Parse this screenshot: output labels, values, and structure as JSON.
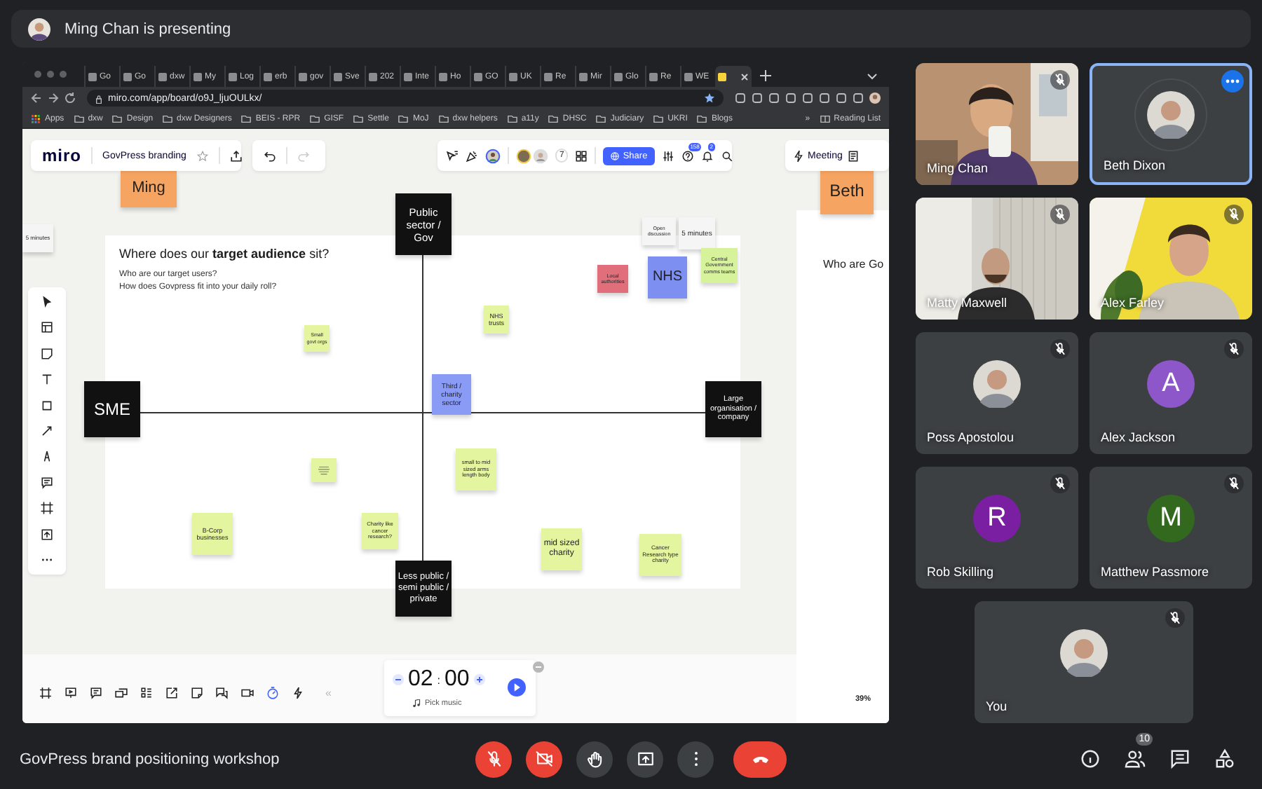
{
  "presenter_banner": {
    "text": "Ming Chan is presenting"
  },
  "browser": {
    "tabs": [
      {
        "label": "Go",
        "selected": false
      },
      {
        "label": "Go",
        "selected": false
      },
      {
        "label": "dxw",
        "selected": false
      },
      {
        "label": "My",
        "selected": false
      },
      {
        "label": "Log",
        "selected": false
      },
      {
        "label": "erb",
        "selected": false
      },
      {
        "label": "gov",
        "selected": false
      },
      {
        "label": "Sve",
        "selected": false
      },
      {
        "label": "202",
        "selected": false
      },
      {
        "label": "Inte",
        "selected": false
      },
      {
        "label": "Ho",
        "selected": false
      },
      {
        "label": "GO",
        "selected": false
      },
      {
        "label": "UK",
        "selected": false
      },
      {
        "label": "Re",
        "selected": false
      },
      {
        "label": "Mir",
        "selected": false
      },
      {
        "label": "Glo",
        "selected": false
      },
      {
        "label": "Re",
        "selected": false
      },
      {
        "label": "WE",
        "selected": false
      },
      {
        "selected": true
      }
    ],
    "address": "miro.com/app/board/o9J_ljuOULkx/",
    "bookmarks": [
      "Apps",
      "dxw",
      "Design",
      "dxw Designers",
      "BEIS - RPR",
      "GISF",
      "Settle",
      "MoJ",
      "dxw helpers",
      "a11y",
      "DHSC",
      "Judiciary",
      "UKRI",
      "Blogs"
    ],
    "bookmarks_more": "»",
    "reading_list": "Reading List"
  },
  "miro": {
    "logo": "miro",
    "board_title": "GovPress branding",
    "collaborator_count": "7",
    "share_label": "Share",
    "help_badge": "158",
    "notifications_badge": "2",
    "meeting_label": "Meeting",
    "frame": {
      "heading": "Where does our **target audience** sit?",
      "lines": [
        "Who are our target users?",
        "How does Govpress fit into your daily roll?"
      ]
    },
    "side_frame_heading": "Who are Go",
    "stickies": [
      {
        "text": "Ming",
        "color": "#f5a462"
      },
      {
        "text": "Beth",
        "color": "#f5a462"
      },
      {
        "text": "5 minutes",
        "color": "#f5f5f5"
      },
      {
        "text": "Public sector / Gov",
        "color": "#111111"
      },
      {
        "text": "Open discussion",
        "color": "#f5f5f5"
      },
      {
        "text": "5 minutes",
        "color": "#f5f5f5"
      },
      {
        "text": "Central Government comms teams",
        "color": "#d6f29b"
      },
      {
        "text": "Local authorities",
        "color": "#e06f7b"
      },
      {
        "text": "NHS",
        "color": "#7d8ff0"
      },
      {
        "text": "NHS trusts",
        "color": "#e3f59f"
      },
      {
        "text": "Small govt orgs",
        "color": "#e3f59f"
      },
      {
        "text": "SME",
        "color": "#111111"
      },
      {
        "text": "Third / charity sector",
        "color": "#8a9bf5"
      },
      {
        "text": "Large organisation / company",
        "color": "#111111"
      },
      {
        "text": "small to mid sized arms length body",
        "color": "#e3f59f"
      },
      {
        "color": "#e3f59f"
      },
      {
        "text": "B-Corp businesses",
        "color": "#e3f59f"
      },
      {
        "text": "Charity like cancer research?",
        "color": "#e3f59f"
      },
      {
        "text": "mid sized charity",
        "color": "#e3f59f"
      },
      {
        "text": "Cancer Research type charity",
        "color": "#e3f59f"
      },
      {
        "text": "Less public / semi public / private",
        "color": "#111111"
      }
    ],
    "collapse": "«",
    "timer": {
      "minutes": "02",
      "separator": ":",
      "seconds": "00",
      "music": "Pick music"
    },
    "zoom": "39%"
  },
  "participants": [
    {
      "name": "Ming Chan",
      "kind": "video",
      "muted": true,
      "highlighted": false
    },
    {
      "name": "Beth Dixon",
      "muted": false,
      "highlighted": true
    },
    {
      "name": "Matty Maxwell",
      "kind": "video",
      "muted": true,
      "highlighted": false
    },
    {
      "name": "Alex Farley",
      "kind": "video",
      "muted": true,
      "highlighted": false
    },
    {
      "name": "Poss Apostolou",
      "muted": true,
      "highlighted": false
    },
    {
      "name": "Alex Jackson",
      "kind": "letter",
      "initial": "A",
      "color": "#8e57c9",
      "muted": true,
      "highlighted": false
    },
    {
      "name": "Rob Skilling",
      "kind": "letter",
      "initial": "R",
      "color": "#7b1fa2",
      "muted": true,
      "highlighted": false
    },
    {
      "name": "Matthew Passmore",
      "kind": "letter",
      "initial": "M",
      "color": "#33691e",
      "muted": true,
      "highlighted": false
    },
    {
      "name": "You",
      "muted": true,
      "highlighted": false
    }
  ],
  "meeting_title": "GovPress brand positioning workshop",
  "controls": [
    {
      "kind": "mic",
      "on": false
    },
    {
      "kind": "camera",
      "on": false
    },
    {
      "kind": "hand"
    },
    {
      "kind": "present"
    },
    {
      "kind": "more"
    },
    {
      "kind": "leave"
    }
  ],
  "side_buttons": [
    {
      "kind": "info"
    },
    {
      "kind": "people",
      "badge": "10"
    },
    {
      "kind": "chat"
    },
    {
      "kind": "activities"
    }
  ]
}
